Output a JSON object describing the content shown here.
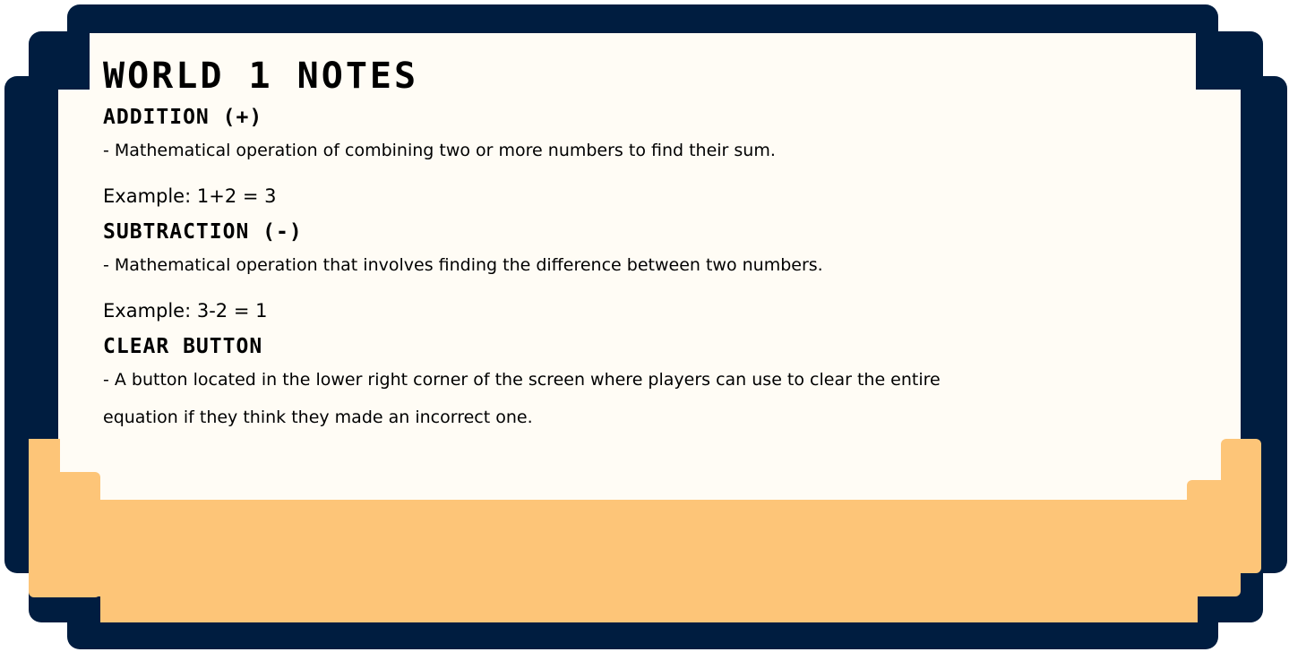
{
  "title": "WORLD 1 NOTES",
  "sections": [
    {
      "heading": "ADDITION (+)",
      "text": "- Mathematical operation of combining two or more numbers to find their sum.",
      "example": "Example: 1+2 = 3"
    },
    {
      "heading": "SUBTRACTION (-)",
      "text": "- Mathematical operation that involves finding the difference between two numbers.",
      "example": "Example: 3-2 = 1"
    },
    {
      "heading": "CLEAR BUTTON",
      "text": "- A button located in the lower right corner of the screen where players can use to clear the entire",
      "text2": "equation if they think they made an incorrect one."
    }
  ],
  "colors": {
    "frame": "#001d40",
    "paper": "#fffcf5",
    "accent": "#fdc578"
  }
}
